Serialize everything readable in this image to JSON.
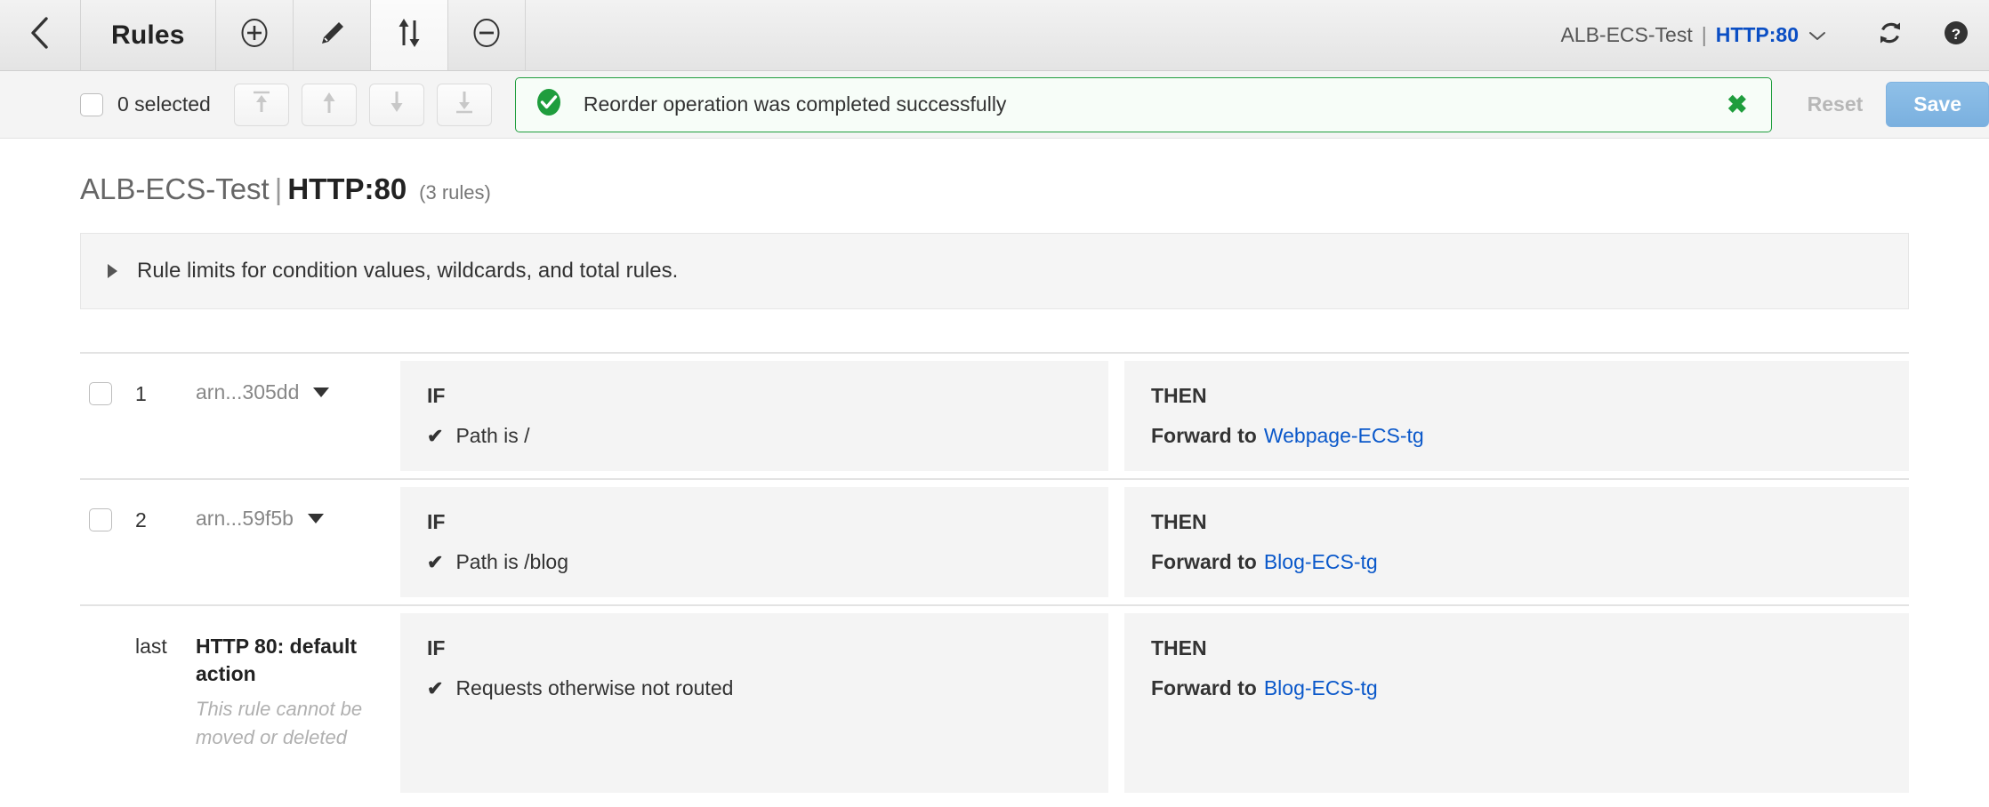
{
  "toolbar": {
    "back_icon": "chevron-left-icon",
    "title": "Rules",
    "buttons": [
      {
        "name": "add-rule-button",
        "icon": "plus-circle-icon"
      },
      {
        "name": "edit-rules-button",
        "icon": "pencil-icon"
      },
      {
        "name": "reorder-rules-button",
        "icon": "sort-updown-icon",
        "active": true
      },
      {
        "name": "delete-rule-button",
        "icon": "minus-circle-icon"
      }
    ],
    "listener": {
      "load_balancer": "ALB-ECS-Test",
      "separator": "|",
      "port": "HTTP:80",
      "chevron": "chevron-down-icon"
    },
    "refresh_icon": "refresh-icon",
    "help_icon": "help-circle-icon"
  },
  "action_bar": {
    "select_all_checkbox": false,
    "selected_label": "0 selected",
    "move_buttons": [
      {
        "name": "move-to-top-button",
        "icon": "arrow-up-to-line-icon"
      },
      {
        "name": "move-up-button",
        "icon": "arrow-up-icon"
      },
      {
        "name": "move-down-button",
        "icon": "arrow-down-icon"
      },
      {
        "name": "move-to-bottom-button",
        "icon": "arrow-down-to-line-icon"
      }
    ],
    "banner": {
      "icon": "success-check-circle-icon",
      "message": "Reorder operation was completed successfully",
      "close": "✖",
      "border_color": "#1f9d3d",
      "background_color": "#f7fdf8"
    },
    "reset_label": "Reset",
    "save_label": "Save",
    "save_color": "#7ab0df"
  },
  "page": {
    "title": {
      "load_balancer": "ALB-ECS-Test",
      "separator": "|",
      "port": "HTTP:80",
      "rule_count": "(3 rules)"
    },
    "limits_panel": {
      "expander_icon": "triangle-right-icon",
      "text": "Rule limits for condition values, wildcards, and total rules."
    }
  },
  "rules": [
    {
      "index": "1",
      "selected": false,
      "arn": "arn...305dd",
      "has_caret": true,
      "if_label": "IF",
      "conditions": [
        {
          "check": "✔",
          "text": "Path is /"
        }
      ],
      "then_label": "THEN",
      "action_prefix": "Forward to",
      "action_target": "Webpage-ECS-tg"
    },
    {
      "index": "2",
      "selected": false,
      "arn": "arn...59f5b",
      "has_caret": true,
      "if_label": "IF",
      "conditions": [
        {
          "check": "✔",
          "text": "Path is /blog"
        }
      ],
      "then_label": "THEN",
      "action_prefix": "Forward to",
      "action_target": "Blog-ECS-tg"
    },
    {
      "index": "last",
      "selected": null,
      "arn": "HTTP 80: default action",
      "note": "This rule cannot be moved or deleted",
      "has_caret": false,
      "if_label": "IF",
      "conditions": [
        {
          "check": "✔",
          "text": "Requests otherwise not routed"
        }
      ],
      "then_label": "THEN",
      "action_prefix": "Forward to",
      "action_target": "Blog-ECS-tg"
    }
  ]
}
